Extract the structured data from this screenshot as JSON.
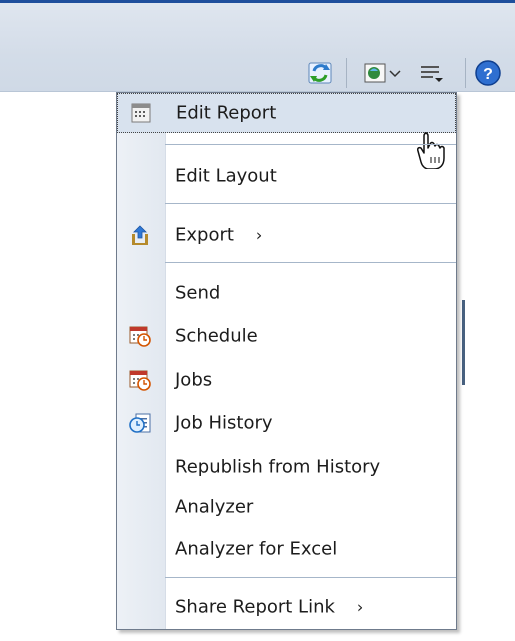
{
  "toolbar": {
    "icons": [
      "refresh-icon",
      "view-icon",
      "chevron-down-icon",
      "actions-menu-icon",
      "help-icon"
    ]
  },
  "menu": {
    "items": [
      {
        "label": "Edit Report",
        "icon": "report-calendar-icon"
      },
      {
        "label": "Edit Layout"
      },
      {
        "label": "Export",
        "icon": "export-icon",
        "submenu": "›"
      },
      {
        "label": "Send"
      },
      {
        "label": "Schedule",
        "icon": "schedule-icon"
      },
      {
        "label": "Jobs",
        "icon": "jobs-icon"
      },
      {
        "label": "Job History",
        "icon": "job-history-icon"
      },
      {
        "label": "Republish from History"
      },
      {
        "label": "Analyzer"
      },
      {
        "label": "Analyzer for Excel"
      },
      {
        "label": "Share Report Link",
        "submenu": "›"
      }
    ]
  },
  "colors": {
    "title_bar": "#1e4f9c",
    "toolbar_bg": "#d3dce8",
    "menu_hover": "#d8e2ee",
    "separator": "#a6b6c9"
  }
}
